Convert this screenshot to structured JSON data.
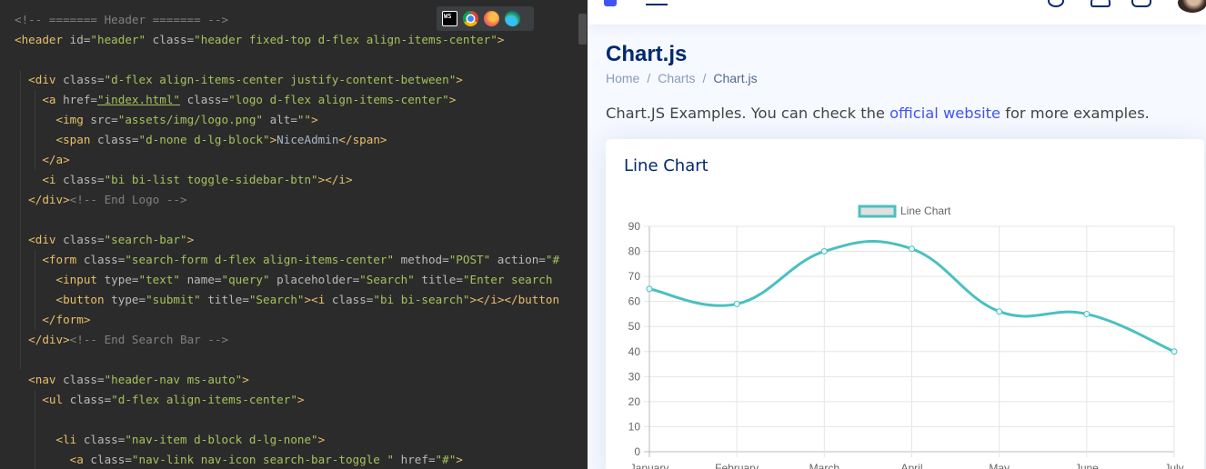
{
  "editor": {
    "lines": [
      [
        [
          "c-comment",
          "<!-- ======= Header ======= -->"
        ]
      ],
      [
        [
          "c-tag",
          "<header "
        ],
        [
          "c-attr",
          "id="
        ],
        [
          "c-val",
          "\"header\""
        ],
        [
          "c-attr",
          " class="
        ],
        [
          "c-val",
          "\"header fixed-top d-flex align-items-center\""
        ],
        [
          "c-tag",
          ">"
        ]
      ],
      [],
      [
        [
          "c-text",
          "  "
        ],
        [
          "c-tag",
          "<div "
        ],
        [
          "c-attr",
          "class="
        ],
        [
          "c-val",
          "\"d-flex align-items-center justify-content-between\""
        ],
        [
          "c-tag",
          ">"
        ]
      ],
      [
        [
          "c-text",
          "    "
        ],
        [
          "c-tag",
          "<a "
        ],
        [
          "c-attr",
          "href="
        ],
        [
          "c-link",
          "\"index.html\""
        ],
        [
          "c-attr",
          " class="
        ],
        [
          "c-val",
          "\"logo d-flex align-items-center\""
        ],
        [
          "c-tag",
          ">"
        ]
      ],
      [
        [
          "c-text",
          "      "
        ],
        [
          "c-tag",
          "<img "
        ],
        [
          "c-attr",
          "src="
        ],
        [
          "c-val",
          "\"assets/img/logo.png\""
        ],
        [
          "c-attr",
          " alt="
        ],
        [
          "c-val",
          "\"\""
        ],
        [
          "c-tag",
          ">"
        ]
      ],
      [
        [
          "c-text",
          "      "
        ],
        [
          "c-tag",
          "<span "
        ],
        [
          "c-attr",
          "class="
        ],
        [
          "c-val",
          "\"d-none d-lg-block\""
        ],
        [
          "c-tag",
          ">"
        ],
        [
          "c-text",
          "NiceAdmin"
        ],
        [
          "c-tag",
          "</span>"
        ]
      ],
      [
        [
          "c-text",
          "    "
        ],
        [
          "c-tag",
          "</a>"
        ]
      ],
      [
        [
          "c-text",
          "    "
        ],
        [
          "c-tag",
          "<i "
        ],
        [
          "c-attr",
          "class="
        ],
        [
          "c-val",
          "\"bi bi-list toggle-sidebar-btn\""
        ],
        [
          "c-tag",
          "></i>"
        ]
      ],
      [
        [
          "c-text",
          "  "
        ],
        [
          "c-tag",
          "</div>"
        ],
        [
          "c-comment",
          "<!-- End Logo -->"
        ]
      ],
      [],
      [
        [
          "c-text",
          "  "
        ],
        [
          "c-tag",
          "<div "
        ],
        [
          "c-attr",
          "class="
        ],
        [
          "c-val",
          "\"search-bar\""
        ],
        [
          "c-tag",
          ">"
        ]
      ],
      [
        [
          "c-text",
          "    "
        ],
        [
          "c-tag",
          "<form "
        ],
        [
          "c-attr",
          "class="
        ],
        [
          "c-val",
          "\"search-form d-flex align-items-center\""
        ],
        [
          "c-attr",
          " method="
        ],
        [
          "c-val",
          "\"POST\""
        ],
        [
          "c-attr",
          " action="
        ],
        [
          "c-val",
          "\"#"
        ]
      ],
      [
        [
          "c-text",
          "      "
        ],
        [
          "c-tag",
          "<input "
        ],
        [
          "c-attr",
          "type="
        ],
        [
          "c-val",
          "\"text\""
        ],
        [
          "c-attr",
          " name="
        ],
        [
          "c-val",
          "\"query\""
        ],
        [
          "c-attr",
          " placeholder="
        ],
        [
          "c-val",
          "\"Search\""
        ],
        [
          "c-attr",
          " title="
        ],
        [
          "c-val",
          "\"Enter search"
        ]
      ],
      [
        [
          "c-text",
          "      "
        ],
        [
          "c-tag",
          "<button "
        ],
        [
          "c-attr",
          "type="
        ],
        [
          "c-val",
          "\"submit\""
        ],
        [
          "c-attr",
          " title="
        ],
        [
          "c-val",
          "\"Search\""
        ],
        [
          "c-tag",
          ">"
        ],
        [
          "c-tag",
          "<i "
        ],
        [
          "c-attr",
          "class="
        ],
        [
          "c-val",
          "\"bi bi-search\""
        ],
        [
          "c-tag",
          "></i></button"
        ]
      ],
      [
        [
          "c-text",
          "    "
        ],
        [
          "c-tag",
          "</form>"
        ]
      ],
      [
        [
          "c-text",
          "  "
        ],
        [
          "c-tag",
          "</div>"
        ],
        [
          "c-comment",
          "<!-- End Search Bar -->"
        ]
      ],
      [],
      [
        [
          "c-text",
          "  "
        ],
        [
          "c-tag",
          "<nav "
        ],
        [
          "c-attr",
          "class="
        ],
        [
          "c-val",
          "\"header-nav ms-auto\""
        ],
        [
          "c-tag",
          ">"
        ]
      ],
      [
        [
          "c-text",
          "    "
        ],
        [
          "c-tag",
          "<ul "
        ],
        [
          "c-attr",
          "class="
        ],
        [
          "c-val",
          "\"d-flex align-items-center\""
        ],
        [
          "c-tag",
          ">"
        ]
      ],
      [],
      [
        [
          "c-text",
          "      "
        ],
        [
          "c-tag",
          "<li "
        ],
        [
          "c-attr",
          "class="
        ],
        [
          "c-val",
          "\"nav-item d-block d-lg-none\""
        ],
        [
          "c-tag",
          ">"
        ]
      ],
      [
        [
          "c-text",
          "        "
        ],
        [
          "c-tag",
          "<a "
        ],
        [
          "c-attr",
          "class="
        ],
        [
          "c-val",
          "\"nav-link nav-icon search-bar-toggle \""
        ],
        [
          "c-attr",
          " href="
        ],
        [
          "c-val",
          "\"#\""
        ],
        [
          "c-tag",
          ">"
        ]
      ]
    ],
    "browser_icons": [
      "webstorm-icon",
      "chrome-icon",
      "firefox-icon",
      "edge-icon"
    ],
    "ws_label": "WS"
  },
  "page": {
    "title": "Chart.js",
    "breadcrumb": [
      {
        "label": "Home",
        "type": "link"
      },
      {
        "label": "Charts",
        "type": "link"
      },
      {
        "label": "Chart.js",
        "type": "active"
      }
    ],
    "intro_before": "Chart.JS Examples. You can check the ",
    "intro_link": "official website",
    "intro_after": " for more examples.",
    "card_title": "Line Chart"
  },
  "colors": {
    "accent": "#4154f1",
    "title": "#012970",
    "line": "#4bc0c0"
  },
  "chart_data": {
    "type": "line",
    "categories": [
      "January",
      "February",
      "March",
      "April",
      "May",
      "June",
      "July"
    ],
    "series": [
      {
        "name": "Line Chart",
        "values": [
          65,
          59,
          80,
          81,
          56,
          55,
          40
        ]
      }
    ],
    "ylim": [
      0,
      90
    ],
    "yticks": [
      0,
      10,
      20,
      30,
      40,
      50,
      60,
      70,
      80,
      90
    ],
    "grid": true,
    "legend": "top-center"
  }
}
